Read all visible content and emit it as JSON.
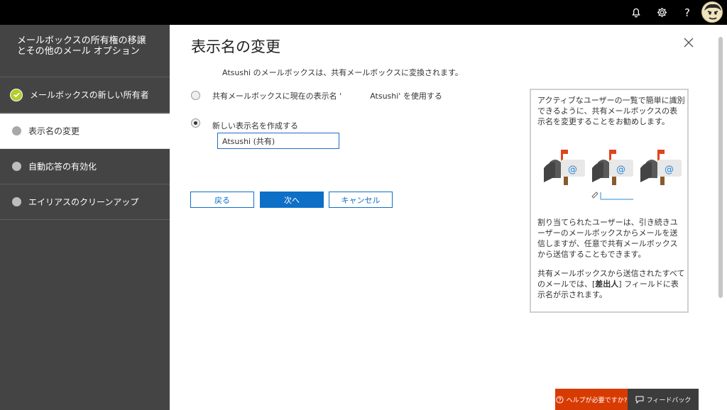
{
  "topbar": {
    "icons": [
      "bell-icon",
      "gear-icon",
      "help-icon",
      "avatar"
    ],
    "help_glyph": "?"
  },
  "sidebar": {
    "title": "メールボックスの所有権の移譲\nとその他のメール オプション",
    "steps": [
      {
        "label": "メールボックスの新しい所有者",
        "state": "completed"
      },
      {
        "label": "表示名の変更",
        "state": "active"
      },
      {
        "label": "自動応答の有効化",
        "state": "pending"
      },
      {
        "label": "エイリアスのクリーンアップ",
        "state": "pending"
      }
    ]
  },
  "main": {
    "title": "表示名の変更",
    "info": "Atsushi のメールボックスは、共有メールボックスに変換されます。",
    "option1_prefix": "共有メールボックスに現在の表示名 '",
    "option1_suffix": "Atsushi' を使用する",
    "option2": "新しい表示名を作成する",
    "input_value": "Atsushi (共有)",
    "buttons": {
      "back": "戻る",
      "next": "次へ",
      "cancel": "キャンセル"
    }
  },
  "panel": {
    "p1": "アクティブなユーザーの一覧で簡単に識別できるように、共有メールボックスの表示名を変更することをお勧めします。",
    "p2": "割り当てられたユーザーは、引き続きユーザーのメールボックスからメールを送信しますが、任意で共有メールボックスから送信することもできます。",
    "p3_pre": "共有メールボックスから送信されたすべてのメールでは、[",
    "p3_bold": "差出人",
    "p3_post": "] フィールドに表示名が示されます。",
    "illustration_icons": [
      "mailbox-icon",
      "mailbox-icon",
      "mailbox-icon",
      "pencil-icon"
    ],
    "at_symbol": "@"
  },
  "footer": {
    "help": "ヘルプが必要ですか?",
    "feedback": "フィードバック"
  },
  "colors": {
    "sidebar": "#444444",
    "accent": "#0e6fc7",
    "check": "#b0cf2d",
    "help": "#d83b01",
    "feedback": "#3c3c3c"
  }
}
